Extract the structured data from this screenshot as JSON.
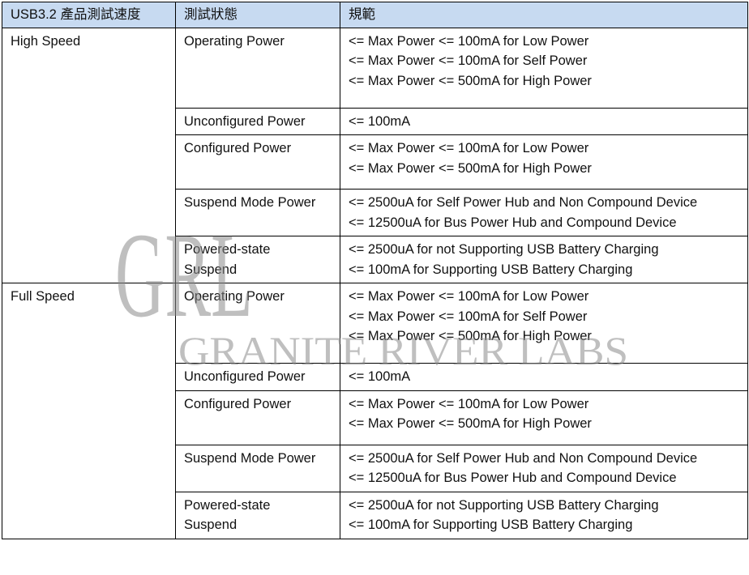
{
  "header": {
    "col1": "USB3.2 產品測試速度",
    "col2": "測試狀態",
    "col3": "規範"
  },
  "watermark": {
    "logo_text": "GRL",
    "company": "GRANITE RIVER LABS",
    "color": "#8a8a8a"
  },
  "groups": [
    {
      "speed": "High Speed",
      "rows": [
        {
          "state": "Operating Power",
          "specs": [
            "<= Max Power <= 100mA for Low Power",
            "<= Max Power <= 100mA for Self Power",
            "<= Max Power <= 500mA for High Power"
          ]
        },
        {
          "state": "Unconfigured Power",
          "specs": [
            "<= 100mA"
          ]
        },
        {
          "state": "Configured Power",
          "specs": [
            "<= Max Power <= 100mA for Low Power",
            "<= Max Power <= 500mA for High Power"
          ]
        },
        {
          "state": "Suspend Mode Power",
          "specs": [
            "<= 2500uA for Self Power Hub and Non Compound Device",
            "<= 12500uA for Bus Power Hub and Compound Device"
          ]
        },
        {
          "state_lines": [
            "Powered-state",
            "Suspend"
          ],
          "specs": [
            "<= 2500uA for not Supporting USB Battery Charging",
            "<= 100mA for Supporting USB Battery Charging"
          ]
        }
      ]
    },
    {
      "speed": "Full Speed",
      "rows": [
        {
          "state": "Operating Power",
          "specs": [
            "<= Max Power <= 100mA for Low Power",
            "<= Max Power <= 100mA for Self Power",
            "<= Max Power <= 500mA for High Power"
          ]
        },
        {
          "state": "Unconfigured Power",
          "specs": [
            "<= 100mA"
          ]
        },
        {
          "state": "Configured Power",
          "specs": [
            "<= Max Power <= 100mA for Low Power",
            "<= Max Power <= 500mA for High Power"
          ]
        },
        {
          "state": "Suspend Mode Power",
          "specs": [
            "<= 2500uA for Self Power Hub and Non Compound Device",
            "<= 12500uA for Bus Power Hub and Compound Device"
          ]
        },
        {
          "state_lines": [
            "Powered-state",
            "Suspend"
          ],
          "specs": [
            "<= 2500uA for not Supporting USB Battery Charging",
            "<= 100mA for Supporting USB Battery Charging"
          ]
        }
      ]
    }
  ]
}
